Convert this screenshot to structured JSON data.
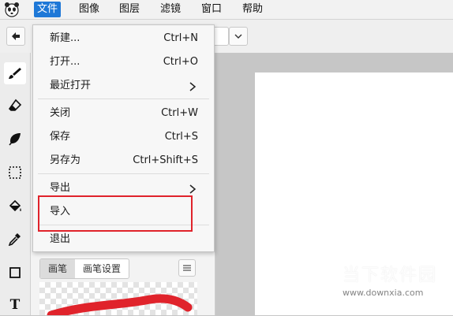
{
  "menubar": {
    "items": [
      "文件",
      "图像",
      "图层",
      "滤镜",
      "窗口",
      "帮助"
    ],
    "active_index": 0
  },
  "file_menu": {
    "items": [
      {
        "label": "新建...",
        "shortcut": "Ctrl+N"
      },
      {
        "label": "打开...",
        "shortcut": "Ctrl+O"
      },
      {
        "label": "最近打开",
        "submenu": true
      },
      {
        "label": "关闭",
        "shortcut": "Ctrl+W"
      },
      {
        "label": "保存",
        "shortcut": "Ctrl+S"
      },
      {
        "label": "另存为",
        "shortcut": "Ctrl+Shift+S"
      },
      {
        "label": "导出",
        "submenu": true
      },
      {
        "label": "导入"
      },
      {
        "label": "退出"
      }
    ],
    "highlighted_item": "导入",
    "highlight_color": "#e0232b"
  },
  "tools": {
    "icons": [
      "brush-icon",
      "eraser-icon",
      "leaf-icon",
      "selection-icon",
      "fill-bucket-icon",
      "eyedropper-icon",
      "rectangle-icon",
      "text-icon"
    ],
    "text_tool_glyph": "T",
    "selected": "brush-icon"
  },
  "brush_panel": {
    "tabs": [
      "画笔",
      "画笔设置"
    ],
    "active_tab": "画笔"
  },
  "watermark": {
    "text": "当下软件园",
    "url": "www.downxia.com"
  },
  "colors": {
    "accent": "#1e78d7",
    "stroke_red": "#e0232b"
  }
}
